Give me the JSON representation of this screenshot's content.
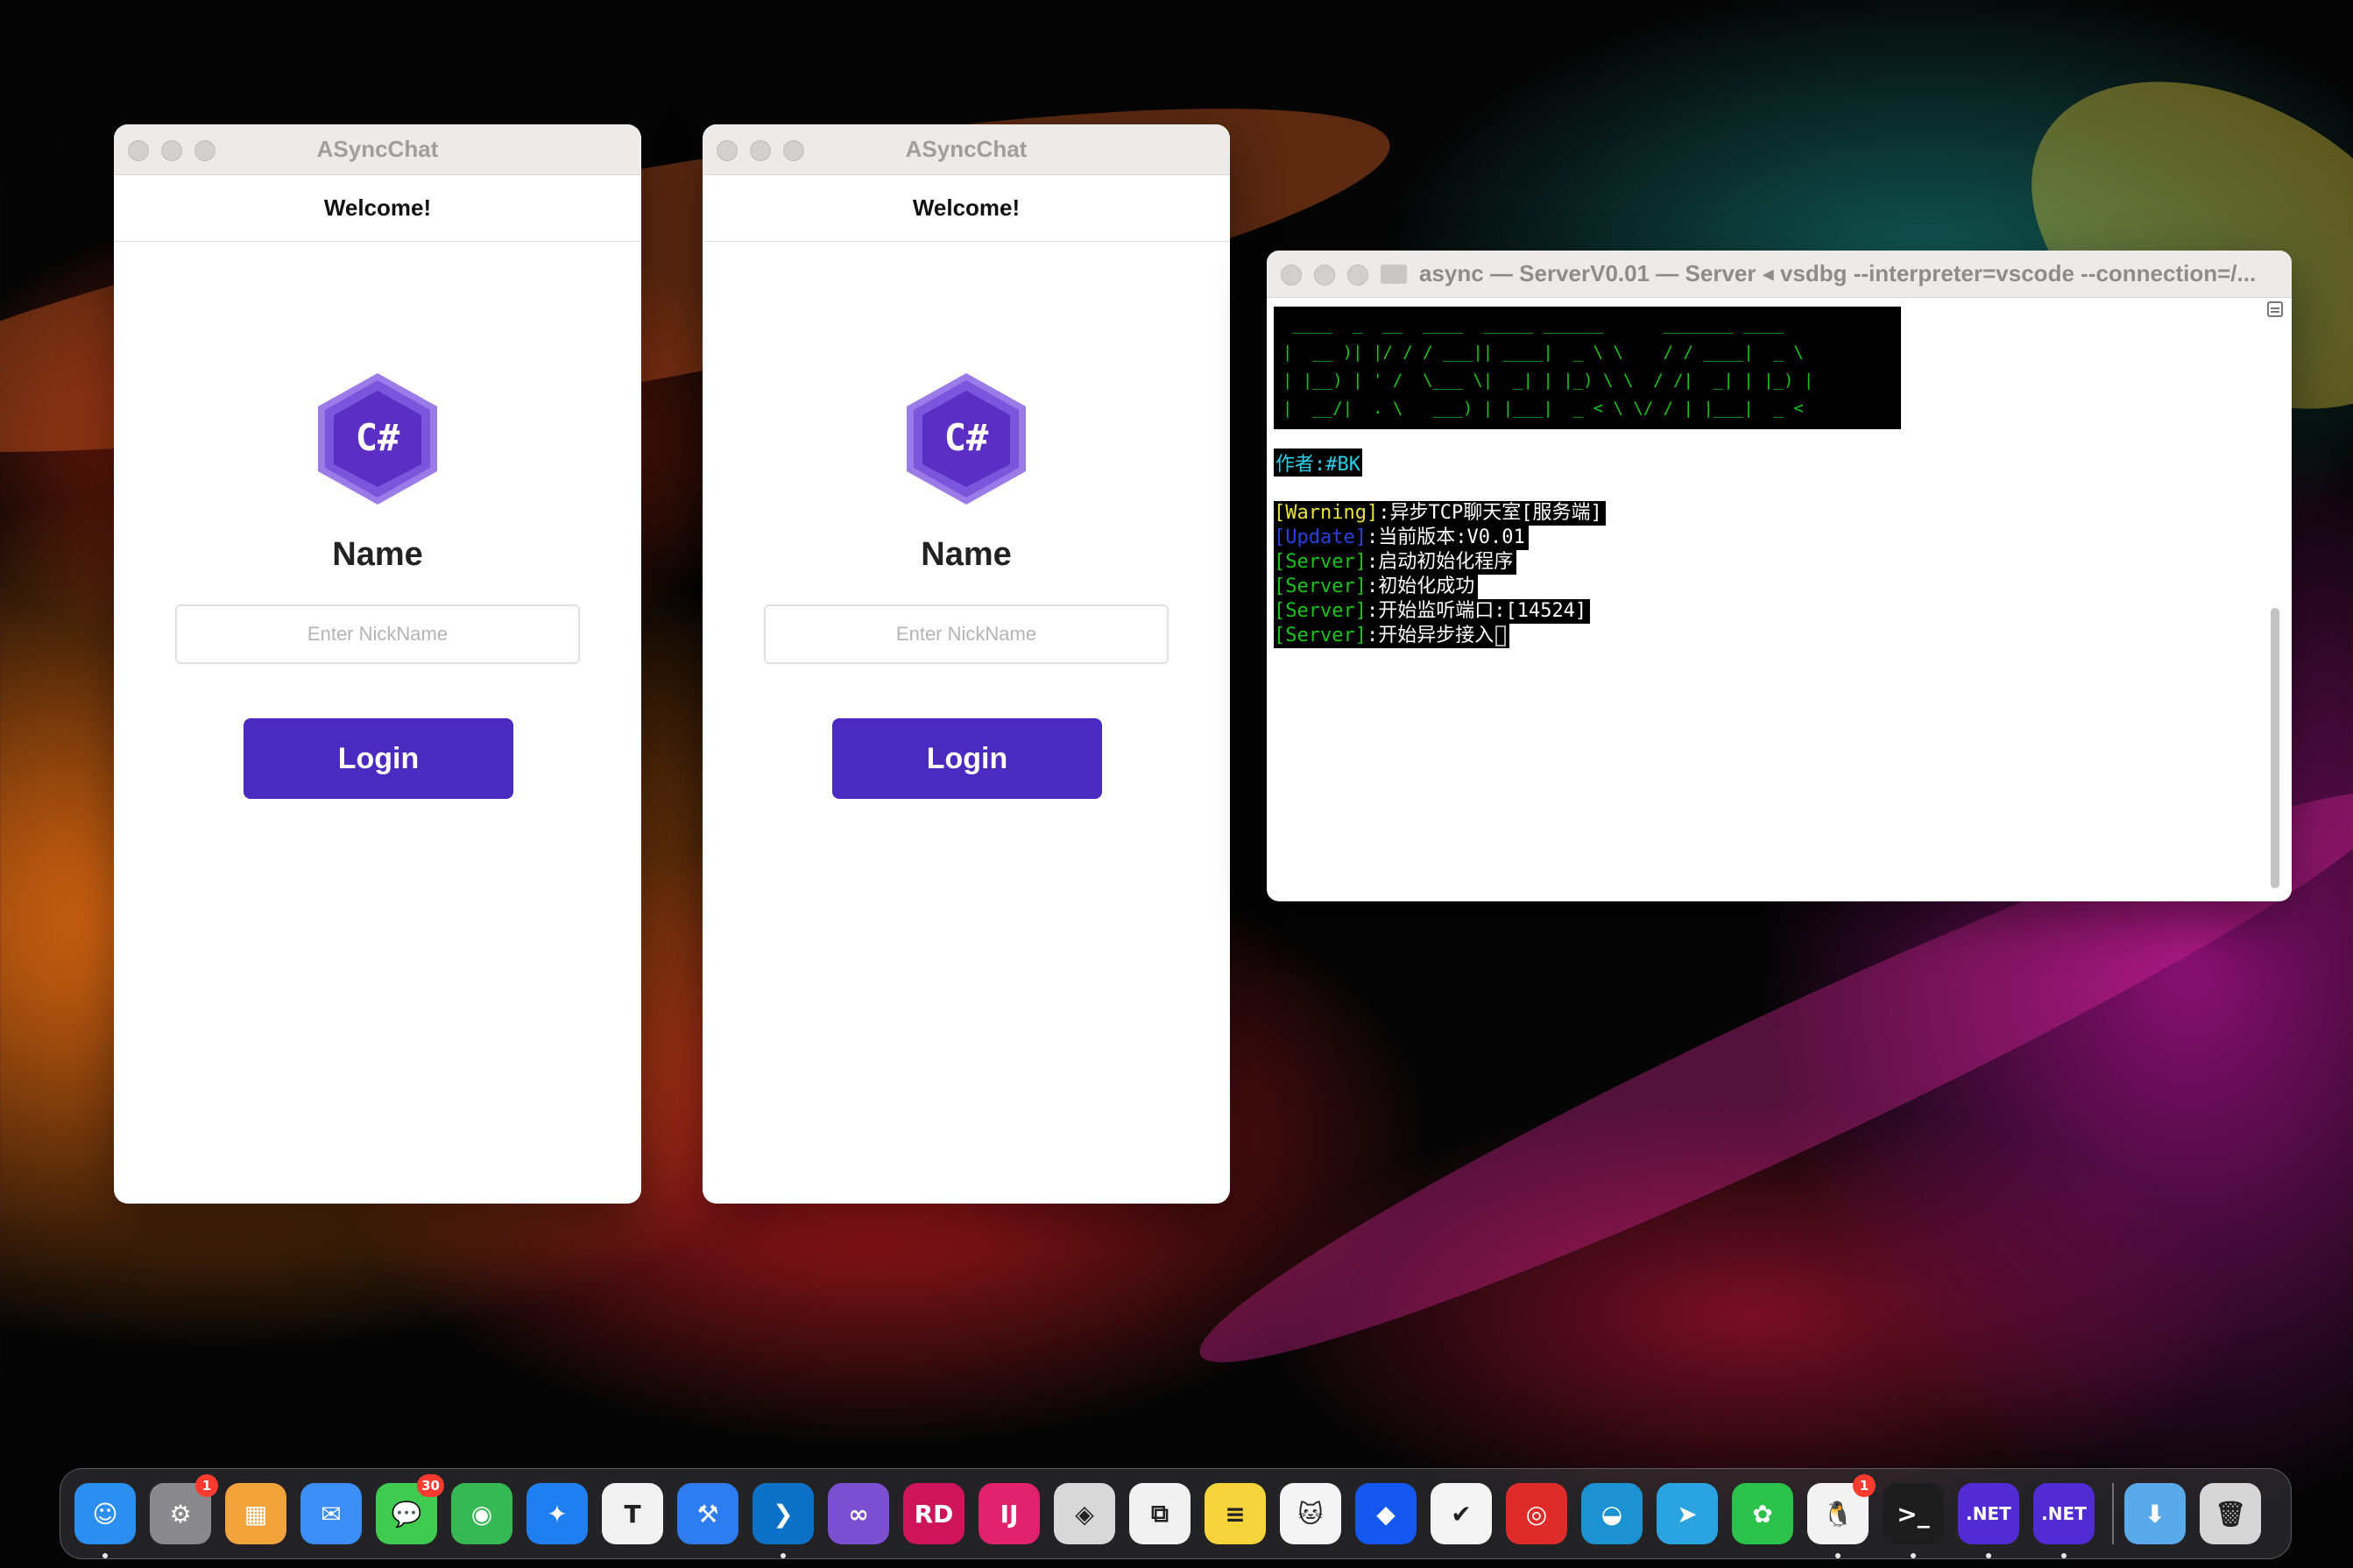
{
  "windows": [
    {
      "title": "ASyncChat",
      "welcome": "Welcome!",
      "logo_text": "C#",
      "heading": "Name",
      "nickname_placeholder": "Enter NickName",
      "login_label": "Login"
    },
    {
      "title": "ASyncChat",
      "welcome": "Welcome!",
      "logo_text": "C#",
      "heading": "Name",
      "nickname_placeholder": "Enter NickName",
      "login_label": "Login"
    }
  ],
  "terminal": {
    "title": "async — ServerV0.01 — Server ◂ vsdbg --interpreter=vscode --connection=/...",
    "banner": " ____  _  __  ____  _____ ______      _______ ____\n|  __ )| |/ / / ___|| ____|  _ \\ \\    / / ____|  _ \\\n| |__) | ' /  \\___ \\|  _| | |_) \\ \\  / /|  _| | |_) |\n|  __/|  . \\   ___) | |___|  _ < \\ \\/ / | |___|  _ <\n|_|   |_|\\_\\ |____/|_____|_| \\_\\ \\__/  |_____|_| \\_\\",
    "author": "作者:#BK",
    "lines": [
      {
        "tag": "[Warning]",
        "text": ":异步TCP聊天室[服务端]"
      },
      {
        "tag": "[Update]",
        "text": ":当前版本:V0.01"
      },
      {
        "tag": "[Server]",
        "text": ":启动初始化程序"
      },
      {
        "tag": "[Server]",
        "text": ":初始化成功"
      },
      {
        "tag": "[Server]",
        "text": ":开始监听端口:[14524]"
      },
      {
        "tag": "[Server]",
        "text": ":开始异步接入"
      }
    ]
  },
  "dock": {
    "items": [
      {
        "name": "finder",
        "glyph": "☺",
        "color": "#2b8ff0",
        "running": true
      },
      {
        "name": "system-settings",
        "glyph": "⚙",
        "color": "#8a8a8e",
        "badge": "1",
        "running": false
      },
      {
        "name": "launchpad",
        "glyph": "▦",
        "color": "#f2a33c",
        "running": false
      },
      {
        "name": "mail",
        "glyph": "✉",
        "color": "#3a8ef5",
        "running": false
      },
      {
        "name": "messages",
        "glyph": "💬",
        "color": "#3ecb4f",
        "badge": "30",
        "running": false
      },
      {
        "name": "find-my",
        "glyph": "◉",
        "color": "#36b954",
        "running": false
      },
      {
        "name": "safari",
        "glyph": "✦",
        "color": "#1f7ff0",
        "running": false
      },
      {
        "name": "typora",
        "glyph": "T",
        "color": "#f2f2f2",
        "running": false
      },
      {
        "name": "xcode",
        "glyph": "⚒",
        "color": "#2d7df0",
        "running": false
      },
      {
        "name": "vscode",
        "glyph": "❯",
        "color": "#0e71c8",
        "running": true
      },
      {
        "name": "visual-studio",
        "glyph": "∞",
        "color": "#7b4fd1",
        "running": false
      },
      {
        "name": "rider",
        "glyph": "RD",
        "color": "#d0145a",
        "running": false
      },
      {
        "name": "intellij",
        "glyph": "IJ",
        "color": "#e0216c",
        "running": false
      },
      {
        "name": "unity",
        "glyph": "◈",
        "color": "#d8d8d8",
        "running": false
      },
      {
        "name": "parallels",
        "glyph": "⧉",
        "color": "#f1f1f1",
        "running": false
      },
      {
        "name": "notes",
        "glyph": "≡",
        "color": "#f5d33a",
        "running": false
      },
      {
        "name": "cat-app",
        "glyph": "🐱",
        "color": "#f4f4f4",
        "running": false
      },
      {
        "name": "lark",
        "glyph": "◆",
        "color": "#1456f0",
        "running": false
      },
      {
        "name": "tick-tick",
        "glyph": "✔",
        "color": "#f4f4f4",
        "running": false
      },
      {
        "name": "netease-music",
        "glyph": "◎",
        "color": "#e02b2b",
        "running": false
      },
      {
        "name": "edge",
        "glyph": "◒",
        "color": "#1c92d2",
        "running": false
      },
      {
        "name": "telegram",
        "glyph": "➤",
        "color": "#2aa3e0",
        "running": false
      },
      {
        "name": "wechat",
        "glyph": "✿",
        "color": "#2bc24c",
        "running": false
      },
      {
        "name": "qq",
        "glyph": "🐧",
        "color": "#f2f2f2",
        "badge": "1",
        "running": true
      },
      {
        "name": "terminal",
        "glyph": ">_",
        "color": "#1d1d1d",
        "running": true
      },
      {
        "name": "dotnet-1",
        "glyph": ".NET",
        "color": "#512bd4",
        "running": true
      },
      {
        "name": "dotnet-2",
        "glyph": ".NET",
        "color": "#512bd4",
        "running": true
      }
    ],
    "folder": {
      "name": "downloads",
      "glyph": "⬇",
      "color": "#5aa9e8"
    },
    "trash": {
      "name": "trash",
      "glyph": "🗑",
      "color": "#d6d6d6"
    }
  }
}
